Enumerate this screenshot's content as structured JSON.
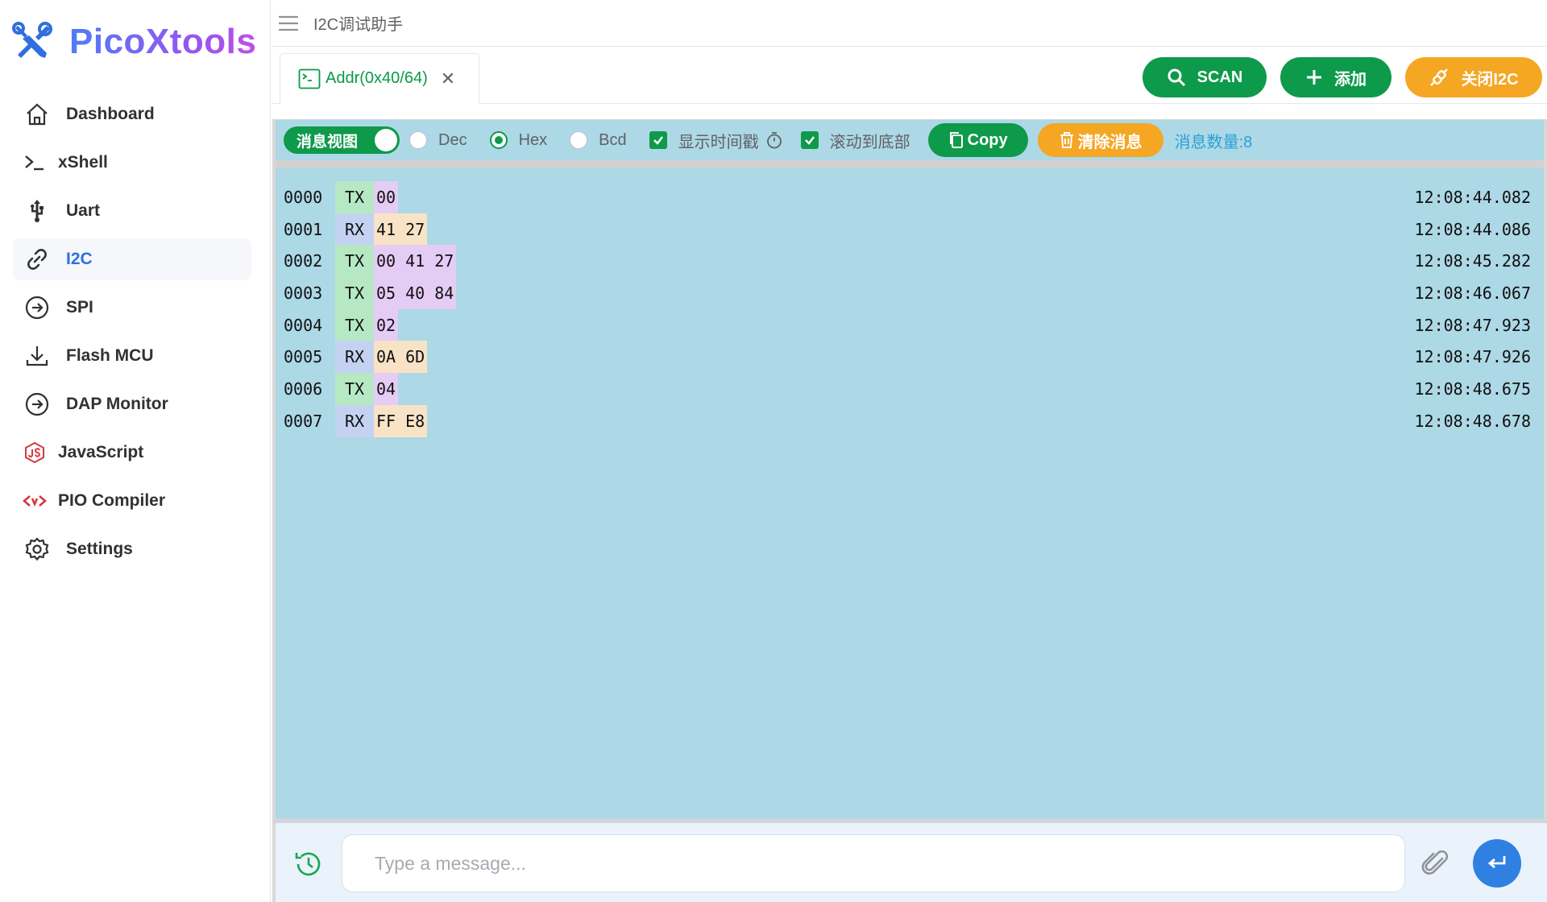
{
  "app": {
    "name": "PicoXtools"
  },
  "sidebar": {
    "items": [
      {
        "label": "Dashboard",
        "icon": "home-icon"
      },
      {
        "label": "xShell",
        "icon": "terminal-icon"
      },
      {
        "label": "Uart",
        "icon": "usb-icon"
      },
      {
        "label": "I2C",
        "icon": "link-icon",
        "active": true
      },
      {
        "label": "SPI",
        "icon": "arrow-circle-icon"
      },
      {
        "label": "Flash MCU",
        "icon": "download-icon"
      },
      {
        "label": "DAP Monitor",
        "icon": "arrow-circle-icon"
      },
      {
        "label": "JavaScript",
        "icon": "js-icon"
      },
      {
        "label": "PIO Compiler",
        "icon": "code-icon"
      },
      {
        "label": "Settings",
        "icon": "gear-icon"
      }
    ]
  },
  "header": {
    "title": "I2C调试助手"
  },
  "tabs": [
    {
      "label": "Addr(0x40/64)",
      "close": "✕"
    }
  ],
  "actions": {
    "scan": "SCAN",
    "add": "添加",
    "close_i2c": "关闭I2C"
  },
  "toolbar": {
    "view_switch": "消息视图",
    "radio_dec": "Dec",
    "radio_hex": "Hex",
    "radio_bcd": "Bcd",
    "selected_format": "Hex",
    "show_timestamp": "显示时间戳",
    "scroll_bottom": "滚动到底部",
    "copy": "Copy",
    "clear": "清除消息",
    "count": "消息数量:8"
  },
  "messages": [
    {
      "idx": "0000",
      "dir": "TX",
      "data": "00",
      "time": "12:08:44.082"
    },
    {
      "idx": "0001",
      "dir": "RX",
      "data": "41 27",
      "time": "12:08:44.086"
    },
    {
      "idx": "0002",
      "dir": "TX",
      "data": "00 41 27",
      "time": "12:08:45.282"
    },
    {
      "idx": "0003",
      "dir": "TX",
      "data": "05 40 84",
      "time": "12:08:46.067"
    },
    {
      "idx": "0004",
      "dir": "TX",
      "data": "02",
      "time": "12:08:47.923"
    },
    {
      "idx": "0005",
      "dir": "RX",
      "data": "0A 6D",
      "time": "12:08:47.926"
    },
    {
      "idx": "0006",
      "dir": "TX",
      "data": "04",
      "time": "12:08:48.675"
    },
    {
      "idx": "0007",
      "dir": "RX",
      "data": "FF E8",
      "time": "12:08:48.678"
    }
  ],
  "input": {
    "placeholder": "Type a message...",
    "value": ""
  },
  "colors": {
    "green": "#0e9a4b",
    "orange": "#f5a623",
    "panel": "#add8e6",
    "active_nav": "#2f6fe0"
  }
}
